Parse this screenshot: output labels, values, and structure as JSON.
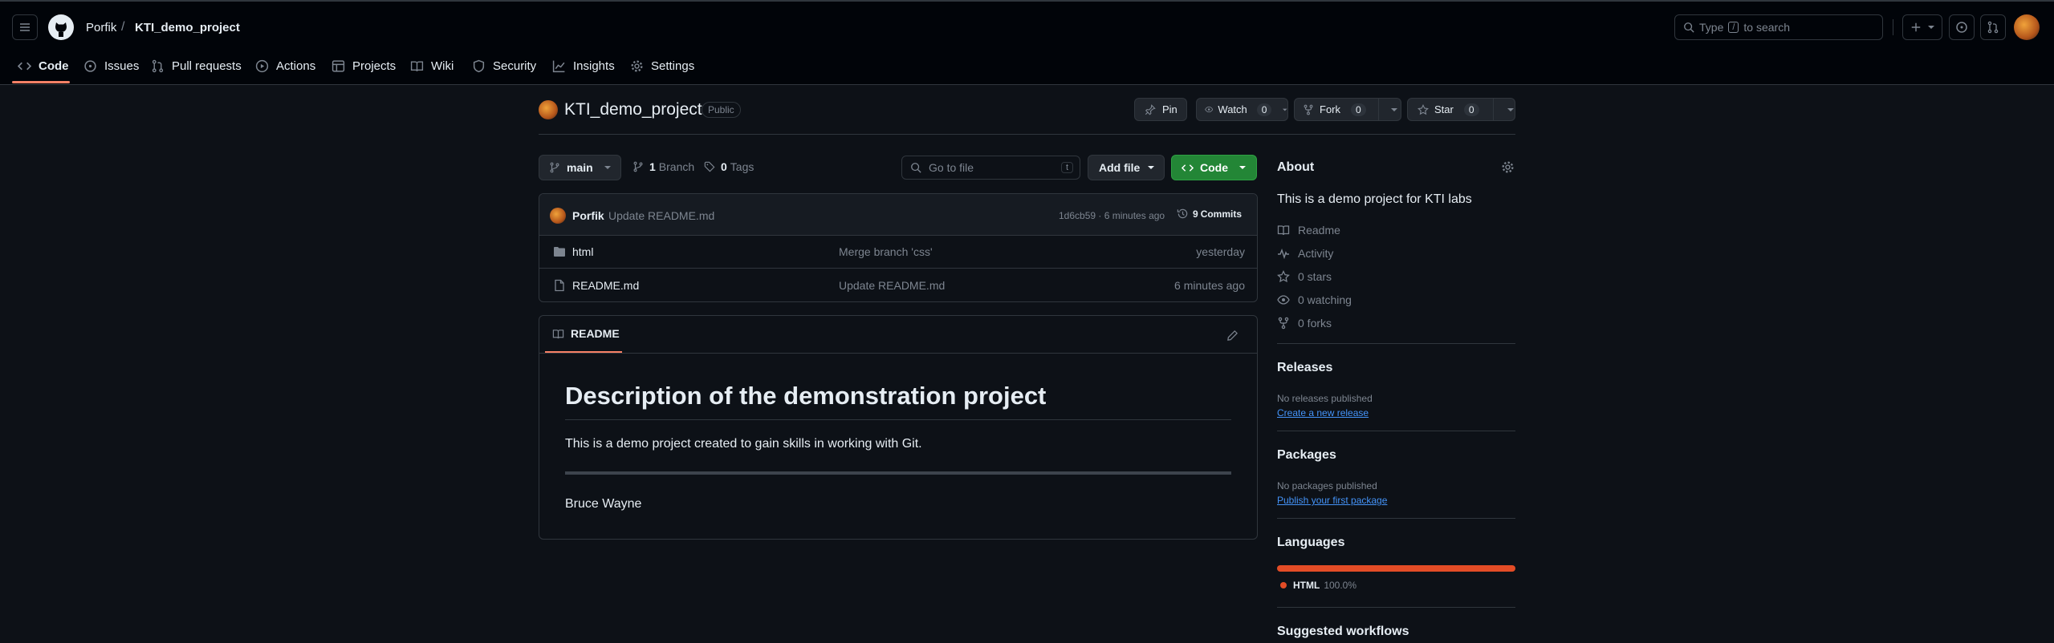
{
  "header": {
    "owner": "Porfik",
    "separator": "/",
    "repo": "KTI_demo_project",
    "search_prefix": "Type",
    "search_key": "/",
    "search_suffix": "to search"
  },
  "tabs": [
    {
      "label": "Code"
    },
    {
      "label": "Issues"
    },
    {
      "label": "Pull requests"
    },
    {
      "label": "Actions"
    },
    {
      "label": "Projects"
    },
    {
      "label": "Wiki"
    },
    {
      "label": "Security"
    },
    {
      "label": "Insights"
    },
    {
      "label": "Settings"
    }
  ],
  "repo_head": {
    "name": "KTI_demo_project",
    "visibility": "Public",
    "pin": "Pin",
    "watch": "Watch",
    "watch_count": "0",
    "fork": "Fork",
    "fork_count": "0",
    "star": "Star",
    "star_count": "0"
  },
  "toolbar": {
    "branch": "main",
    "branch_count": "1",
    "branch_label": "Branch",
    "tags_count": "0",
    "tags_label": "Tags",
    "goto_placeholder": "Go to file",
    "goto_key": "t",
    "add_file": "Add file",
    "code": "Code"
  },
  "commit": {
    "author": "Porfik",
    "message": "Update README.md",
    "hash_time": "1d6cb59 · 6 minutes ago",
    "commits_count": "9",
    "commits_label": "Commits"
  },
  "files": [
    {
      "name": "html",
      "message": "Merge branch 'css'",
      "time": "yesterday",
      "type": "folder"
    },
    {
      "name": "README.md",
      "message": "Update README.md",
      "time": "6 minutes ago",
      "type": "file"
    }
  ],
  "readme": {
    "tab": "README",
    "heading": "Description of the demonstration project",
    "paragraph": "This is a demo project created to gain skills in working with Git.",
    "signature": "Bruce Wayne"
  },
  "about": {
    "title": "About",
    "description": "This is a demo project for KTI labs",
    "readme": "Readme",
    "activity": "Activity",
    "stars": "0 stars",
    "watching": "0 watching",
    "forks": "0 forks"
  },
  "releases": {
    "title": "Releases",
    "none": "No releases published",
    "create": "Create a new release"
  },
  "packages": {
    "title": "Packages",
    "none": "No packages published",
    "publish": "Publish your first package"
  },
  "languages": {
    "title": "Languages",
    "name": "HTML",
    "percent": "100.0%",
    "share": 1.0,
    "color": "#e34c26"
  },
  "workflows": {
    "title": "Suggested workflows"
  },
  "colors": {
    "accent": "#f78166",
    "green_button": "#238636",
    "link": "#4493f8"
  }
}
